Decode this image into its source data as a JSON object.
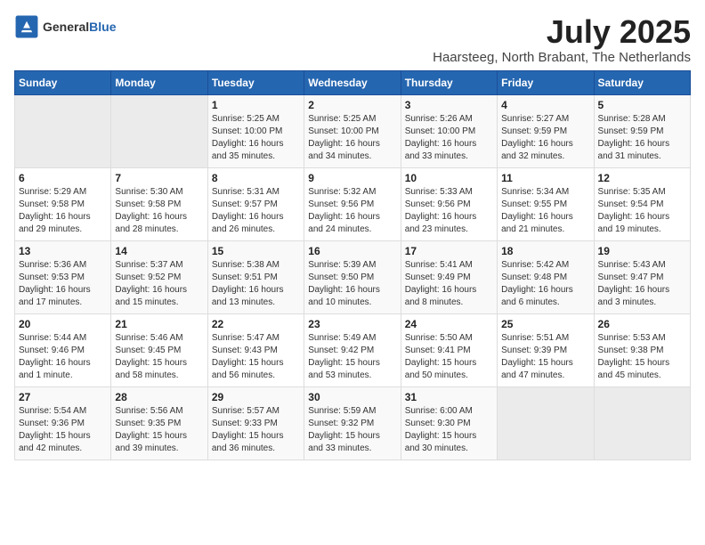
{
  "header": {
    "logo_general": "General",
    "logo_blue": "Blue",
    "month_title": "July 2025",
    "subtitle": "Haarsteeg, North Brabant, The Netherlands"
  },
  "days_of_week": [
    "Sunday",
    "Monday",
    "Tuesday",
    "Wednesday",
    "Thursday",
    "Friday",
    "Saturday"
  ],
  "weeks": [
    [
      {
        "day": "",
        "content": ""
      },
      {
        "day": "",
        "content": ""
      },
      {
        "day": "1",
        "content": "Sunrise: 5:25 AM\nSunset: 10:00 PM\nDaylight: 16 hours and 35 minutes."
      },
      {
        "day": "2",
        "content": "Sunrise: 5:25 AM\nSunset: 10:00 PM\nDaylight: 16 hours and 34 minutes."
      },
      {
        "day": "3",
        "content": "Sunrise: 5:26 AM\nSunset: 10:00 PM\nDaylight: 16 hours and 33 minutes."
      },
      {
        "day": "4",
        "content": "Sunrise: 5:27 AM\nSunset: 9:59 PM\nDaylight: 16 hours and 32 minutes."
      },
      {
        "day": "5",
        "content": "Sunrise: 5:28 AM\nSunset: 9:59 PM\nDaylight: 16 hours and 31 minutes."
      }
    ],
    [
      {
        "day": "6",
        "content": "Sunrise: 5:29 AM\nSunset: 9:58 PM\nDaylight: 16 hours and 29 minutes."
      },
      {
        "day": "7",
        "content": "Sunrise: 5:30 AM\nSunset: 9:58 PM\nDaylight: 16 hours and 28 minutes."
      },
      {
        "day": "8",
        "content": "Sunrise: 5:31 AM\nSunset: 9:57 PM\nDaylight: 16 hours and 26 minutes."
      },
      {
        "day": "9",
        "content": "Sunrise: 5:32 AM\nSunset: 9:56 PM\nDaylight: 16 hours and 24 minutes."
      },
      {
        "day": "10",
        "content": "Sunrise: 5:33 AM\nSunset: 9:56 PM\nDaylight: 16 hours and 23 minutes."
      },
      {
        "day": "11",
        "content": "Sunrise: 5:34 AM\nSunset: 9:55 PM\nDaylight: 16 hours and 21 minutes."
      },
      {
        "day": "12",
        "content": "Sunrise: 5:35 AM\nSunset: 9:54 PM\nDaylight: 16 hours and 19 minutes."
      }
    ],
    [
      {
        "day": "13",
        "content": "Sunrise: 5:36 AM\nSunset: 9:53 PM\nDaylight: 16 hours and 17 minutes."
      },
      {
        "day": "14",
        "content": "Sunrise: 5:37 AM\nSunset: 9:52 PM\nDaylight: 16 hours and 15 minutes."
      },
      {
        "day": "15",
        "content": "Sunrise: 5:38 AM\nSunset: 9:51 PM\nDaylight: 16 hours and 13 minutes."
      },
      {
        "day": "16",
        "content": "Sunrise: 5:39 AM\nSunset: 9:50 PM\nDaylight: 16 hours and 10 minutes."
      },
      {
        "day": "17",
        "content": "Sunrise: 5:41 AM\nSunset: 9:49 PM\nDaylight: 16 hours and 8 minutes."
      },
      {
        "day": "18",
        "content": "Sunrise: 5:42 AM\nSunset: 9:48 PM\nDaylight: 16 hours and 6 minutes."
      },
      {
        "day": "19",
        "content": "Sunrise: 5:43 AM\nSunset: 9:47 PM\nDaylight: 16 hours and 3 minutes."
      }
    ],
    [
      {
        "day": "20",
        "content": "Sunrise: 5:44 AM\nSunset: 9:46 PM\nDaylight: 16 hours and 1 minute."
      },
      {
        "day": "21",
        "content": "Sunrise: 5:46 AM\nSunset: 9:45 PM\nDaylight: 15 hours and 58 minutes."
      },
      {
        "day": "22",
        "content": "Sunrise: 5:47 AM\nSunset: 9:43 PM\nDaylight: 15 hours and 56 minutes."
      },
      {
        "day": "23",
        "content": "Sunrise: 5:49 AM\nSunset: 9:42 PM\nDaylight: 15 hours and 53 minutes."
      },
      {
        "day": "24",
        "content": "Sunrise: 5:50 AM\nSunset: 9:41 PM\nDaylight: 15 hours and 50 minutes."
      },
      {
        "day": "25",
        "content": "Sunrise: 5:51 AM\nSunset: 9:39 PM\nDaylight: 15 hours and 47 minutes."
      },
      {
        "day": "26",
        "content": "Sunrise: 5:53 AM\nSunset: 9:38 PM\nDaylight: 15 hours and 45 minutes."
      }
    ],
    [
      {
        "day": "27",
        "content": "Sunrise: 5:54 AM\nSunset: 9:36 PM\nDaylight: 15 hours and 42 minutes."
      },
      {
        "day": "28",
        "content": "Sunrise: 5:56 AM\nSunset: 9:35 PM\nDaylight: 15 hours and 39 minutes."
      },
      {
        "day": "29",
        "content": "Sunrise: 5:57 AM\nSunset: 9:33 PM\nDaylight: 15 hours and 36 minutes."
      },
      {
        "day": "30",
        "content": "Sunrise: 5:59 AM\nSunset: 9:32 PM\nDaylight: 15 hours and 33 minutes."
      },
      {
        "day": "31",
        "content": "Sunrise: 6:00 AM\nSunset: 9:30 PM\nDaylight: 15 hours and 30 minutes."
      },
      {
        "day": "",
        "content": ""
      },
      {
        "day": "",
        "content": ""
      }
    ]
  ]
}
